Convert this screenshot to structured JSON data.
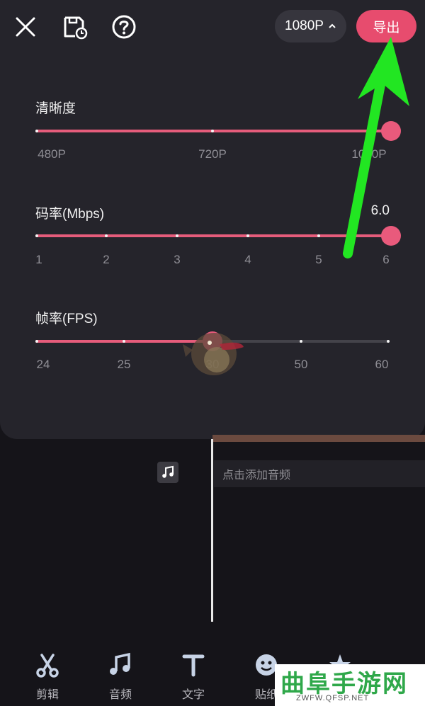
{
  "header": {
    "resolution_pill": "1080P",
    "export_label": "导出"
  },
  "resolution": {
    "title": "清晰度",
    "ticks": [
      "480P",
      "720P",
      "1080P"
    ],
    "selected": "1080P"
  },
  "bitrate": {
    "title": "码率(Mbps)",
    "value": "6.0",
    "ticks": [
      "1",
      "2",
      "3",
      "4",
      "5",
      "6"
    ]
  },
  "framerate": {
    "title": "帧率(FPS)",
    "ticks": [
      "24",
      "25",
      "30",
      "50",
      "60"
    ],
    "selected": "30"
  },
  "timeline": {
    "audio_hint": "点击添加音频"
  },
  "toolbar": {
    "items": [
      {
        "label": "剪辑",
        "icon": "scissors-icon"
      },
      {
        "label": "音频",
        "icon": "music-note-icon"
      },
      {
        "label": "文字",
        "icon": "text-icon"
      },
      {
        "label": "贴纸",
        "icon": "sticker-icon"
      }
    ]
  },
  "watermark": {
    "title": "曲阜手游网",
    "url": "ZWFW.QFSP.NET"
  },
  "colors": {
    "accent": "#e74c6e",
    "panel": "#25242b",
    "background": "#151419",
    "annotation_arrow": "#22e622"
  }
}
